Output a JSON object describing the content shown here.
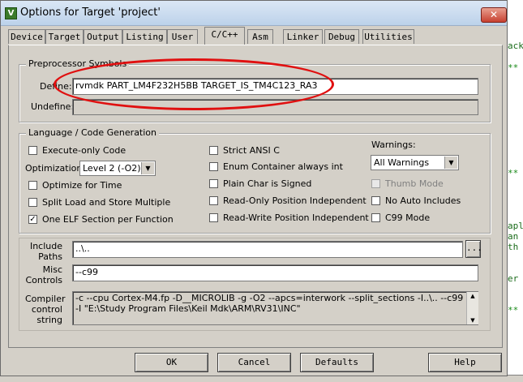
{
  "background": {
    "snippets": [
      "ack",
      "**",
      "**",
      "apl",
      " an",
      "th",
      "er",
      "**"
    ]
  },
  "window": {
    "icon_letter": "V",
    "title": "Options for Target 'project'",
    "close": "✕"
  },
  "tabs": [
    {
      "label": "Device"
    },
    {
      "label": "Target"
    },
    {
      "label": "Output"
    },
    {
      "label": "Listing"
    },
    {
      "label": "User"
    },
    {
      "label": "C/C++"
    },
    {
      "label": "Asm"
    },
    {
      "label": "Linker"
    },
    {
      "label": "Debug"
    },
    {
      "label": "Utilities"
    }
  ],
  "preprocessor": {
    "legend": "Preprocessor Symbols",
    "define_label": "Define:",
    "define_value": "rvmdk PART_LM4F232H5BB TARGET_IS_TM4C123_RA3",
    "undefine_label": "Undefine:",
    "undefine_value": ""
  },
  "language": {
    "legend": "Language / Code Generation",
    "execute_only": "Execute-only Code",
    "optimization_label": "Optimization:",
    "optimization_value": "Level 2 (-O2)",
    "optimize_time": "Optimize for Time",
    "split_load": "Split Load and Store Multiple",
    "one_elf": "One ELF Section per Function",
    "strict_ansi": "Strict ANSI C",
    "enum_container": "Enum Container always int",
    "plain_char": "Plain Char is Signed",
    "ropi": "Read-Only Position Independent",
    "rwpi": "Read-Write Position Independent",
    "warnings_label": "Warnings:",
    "warnings_value": "All Warnings",
    "thumb_mode": "Thumb Mode",
    "no_auto": "No Auto Includes",
    "c99": "C99 Mode",
    "check_mark": "✓"
  },
  "include": {
    "label_1": "Include",
    "label_2": "Paths",
    "value": "..\\..",
    "browse": "..."
  },
  "misc": {
    "label_1": "Misc",
    "label_2": "Controls",
    "value": "--c99"
  },
  "compiler": {
    "label_1": "Compiler",
    "label_2": "control",
    "label_3": "string",
    "line_1": "-c --cpu Cortex-M4.fp -D__MICROLIB -g -O2 --apcs=interwork --split_sections -I..\\.. --c99",
    "line_2": "-I \"E:\\Study Program Files\\Keil Mdk\\ARM\\RV31\\INC\""
  },
  "buttons": {
    "ok": "OK",
    "cancel": "Cancel",
    "defaults": "Defaults",
    "help": "Help"
  },
  "colors": {
    "highlight_oval": "#e01010"
  }
}
